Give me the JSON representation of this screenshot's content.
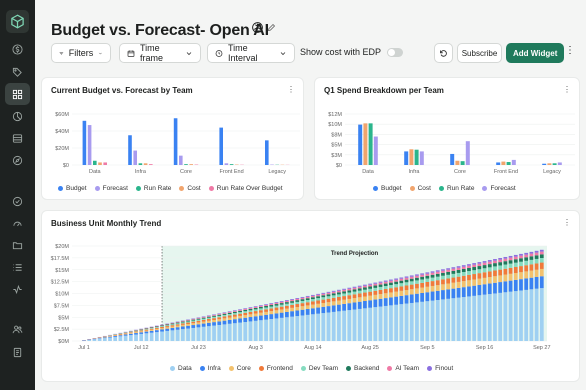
{
  "page": {
    "title": "Budget vs. Forecast- Open AI"
  },
  "sidebar": {
    "items": [
      {
        "icon": "dollar-icon"
      },
      {
        "icon": "tag-icon"
      },
      {
        "icon": "dashboard-grid-icon",
        "active": true
      },
      {
        "icon": "pie-chart-icon"
      },
      {
        "icon": "table-icon"
      },
      {
        "icon": "compass-icon"
      },
      {
        "icon": "check-circle-icon"
      },
      {
        "icon": "gauge-icon"
      },
      {
        "icon": "folder-icon"
      },
      {
        "icon": "list-icon"
      },
      {
        "icon": "activity-icon"
      },
      {
        "icon": "users-icon"
      },
      {
        "icon": "receipt-icon"
      }
    ]
  },
  "toolbar": {
    "filters_label": "Filters",
    "timeframe_label": "Time frame",
    "interval_label": "Time Interval",
    "edp_label": "Show cost with EDP",
    "edp_on": false,
    "subscribe_label": "Subscribe",
    "add_widget_label": "Add Widget"
  },
  "colors": {
    "budget": "#3a82f2",
    "forecast": "#a89bef",
    "run_rate": "#2bb58c",
    "cost": "#f1a56e",
    "run_rate_over_budget": "#ef7aa6",
    "accent": "#1f7a5c"
  },
  "widgets": {
    "budget_vs_forecast": {
      "title": "Current Budget vs. Forecast by Team",
      "legend": [
        "Budget",
        "Forecast",
        "Run Rate",
        "Cost",
        "Run Rate Over Budget"
      ]
    },
    "q1_spend": {
      "title": "Q1 Spend Breakdown per Team",
      "legend": [
        "Budget",
        "Cost",
        "Run Rate",
        "Forecast"
      ]
    },
    "monthly_trend": {
      "title": "Business Unit Monthly Trend",
      "annotation": "Trend Projection",
      "legend": [
        "Data",
        "Infra",
        "Core",
        "Frontend",
        "Dev Team",
        "Backend",
        "AI Team",
        "Finout"
      ]
    }
  },
  "chart_data": [
    {
      "type": "bar",
      "title": "Current Budget vs. Forecast by Team",
      "categories": [
        "Data",
        "Infra",
        "Core",
        "Front End",
        "Legacy"
      ],
      "y_ticks": [
        "$0",
        "$20M",
        "$40M",
        "$60M"
      ],
      "ylim": [
        0,
        60
      ],
      "unit": "$M",
      "series": [
        {
          "name": "Budget",
          "values": [
            52,
            35,
            55,
            44,
            29
          ]
        },
        {
          "name": "Forecast",
          "values": [
            47,
            17,
            11,
            2,
            0.5
          ]
        },
        {
          "name": "Run Rate",
          "values": [
            5,
            2,
            1,
            1,
            0.3
          ]
        },
        {
          "name": "Cost",
          "values": [
            3,
            2,
            1,
            0.5,
            0.3
          ]
        },
        {
          "name": "Run Rate Over Budget",
          "values": [
            3,
            1,
            0.5,
            0.3,
            0.2
          ]
        }
      ],
      "legend_position": "bottom"
    },
    {
      "type": "bar",
      "title": "Q1 Spend Breakdown per Team",
      "categories": [
        "Data",
        "Infra",
        "Core",
        "Front End",
        "Legacy"
      ],
      "y_ticks": [
        "$0",
        "$3M",
        "$5M",
        "$8M",
        "$10M",
        "$12M"
      ],
      "ylim": [
        0,
        12
      ],
      "unit": "$M",
      "series": [
        {
          "name": "Budget",
          "values": [
            9.5,
            3.2,
            2.6,
            0.6,
            0.3
          ]
        },
        {
          "name": "Cost",
          "values": [
            9.8,
            3.7,
            1.0,
            0.8,
            0.4
          ]
        },
        {
          "name": "Run Rate",
          "values": [
            9.8,
            3.6,
            0.9,
            0.7,
            0.4
          ]
        },
        {
          "name": "Forecast",
          "values": [
            6.7,
            3.2,
            5.6,
            1.2,
            0.6
          ]
        }
      ],
      "legend_position": "bottom"
    },
    {
      "type": "bar",
      "stacked": true,
      "title": "Business Unit Monthly Trend",
      "x_ticks": [
        "Jul 1",
        "Jul 12",
        "Jul 23",
        "Aug 3",
        "Aug 14",
        "Aug 25",
        "Sep 5",
        "Sep 16",
        "Sep 27"
      ],
      "y_ticks": [
        "$0M",
        "$2.5M",
        "$5M",
        "$7.5M",
        "$10M",
        "$12.5M",
        "$15M",
        "$17.5M",
        "$20M"
      ],
      "ylim": [
        0,
        20
      ],
      "unit": "$M",
      "x_range": [
        "Jul 1",
        "Sep 28"
      ],
      "projection_start": "Jul 16",
      "annotation": "Trend Projection",
      "total_start": 0.2,
      "total_end": 19.2,
      "series": [
        {
          "name": "Data",
          "share": 0.58
        },
        {
          "name": "Infra",
          "share": 0.13
        },
        {
          "name": "Core",
          "share": 0.08
        },
        {
          "name": "Frontend",
          "share": 0.07
        },
        {
          "name": "Dev Team",
          "share": 0.05
        },
        {
          "name": "Backend",
          "share": 0.04
        },
        {
          "name": "AI Team",
          "share": 0.03
        },
        {
          "name": "Finout",
          "share": 0.02
        }
      ],
      "legend_position": "bottom"
    }
  ]
}
